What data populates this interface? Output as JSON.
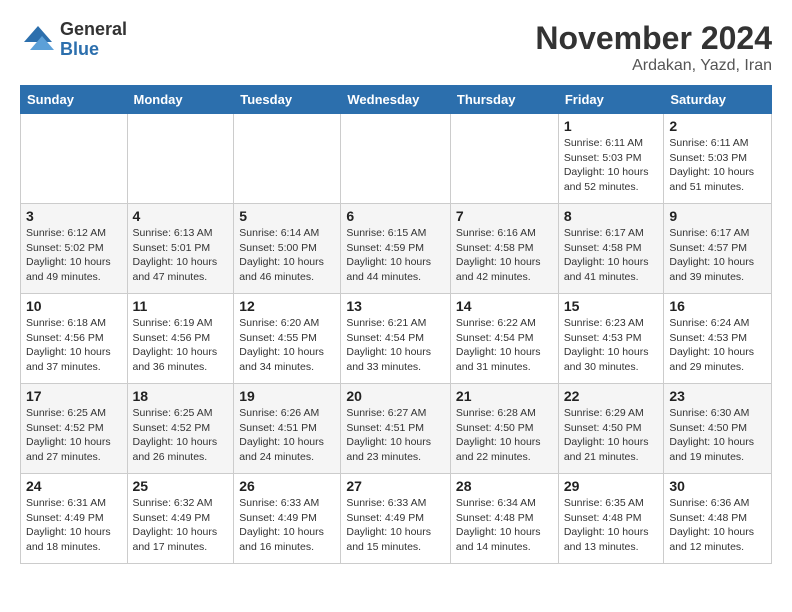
{
  "logo": {
    "general": "General",
    "blue": "Blue"
  },
  "title": "November 2024",
  "location": "Ardakan, Yazd, Iran",
  "weekdays": [
    "Sunday",
    "Monday",
    "Tuesday",
    "Wednesday",
    "Thursday",
    "Friday",
    "Saturday"
  ],
  "weeks": [
    [
      {
        "day": "",
        "info": ""
      },
      {
        "day": "",
        "info": ""
      },
      {
        "day": "",
        "info": ""
      },
      {
        "day": "",
        "info": ""
      },
      {
        "day": "",
        "info": ""
      },
      {
        "day": "1",
        "info": "Sunrise: 6:11 AM\nSunset: 5:03 PM\nDaylight: 10 hours\nand 52 minutes."
      },
      {
        "day": "2",
        "info": "Sunrise: 6:11 AM\nSunset: 5:03 PM\nDaylight: 10 hours\nand 51 minutes."
      }
    ],
    [
      {
        "day": "3",
        "info": "Sunrise: 6:12 AM\nSunset: 5:02 PM\nDaylight: 10 hours\nand 49 minutes."
      },
      {
        "day": "4",
        "info": "Sunrise: 6:13 AM\nSunset: 5:01 PM\nDaylight: 10 hours\nand 47 minutes."
      },
      {
        "day": "5",
        "info": "Sunrise: 6:14 AM\nSunset: 5:00 PM\nDaylight: 10 hours\nand 46 minutes."
      },
      {
        "day": "6",
        "info": "Sunrise: 6:15 AM\nSunset: 4:59 PM\nDaylight: 10 hours\nand 44 minutes."
      },
      {
        "day": "7",
        "info": "Sunrise: 6:16 AM\nSunset: 4:58 PM\nDaylight: 10 hours\nand 42 minutes."
      },
      {
        "day": "8",
        "info": "Sunrise: 6:17 AM\nSunset: 4:58 PM\nDaylight: 10 hours\nand 41 minutes."
      },
      {
        "day": "9",
        "info": "Sunrise: 6:17 AM\nSunset: 4:57 PM\nDaylight: 10 hours\nand 39 minutes."
      }
    ],
    [
      {
        "day": "10",
        "info": "Sunrise: 6:18 AM\nSunset: 4:56 PM\nDaylight: 10 hours\nand 37 minutes."
      },
      {
        "day": "11",
        "info": "Sunrise: 6:19 AM\nSunset: 4:56 PM\nDaylight: 10 hours\nand 36 minutes."
      },
      {
        "day": "12",
        "info": "Sunrise: 6:20 AM\nSunset: 4:55 PM\nDaylight: 10 hours\nand 34 minutes."
      },
      {
        "day": "13",
        "info": "Sunrise: 6:21 AM\nSunset: 4:54 PM\nDaylight: 10 hours\nand 33 minutes."
      },
      {
        "day": "14",
        "info": "Sunrise: 6:22 AM\nSunset: 4:54 PM\nDaylight: 10 hours\nand 31 minutes."
      },
      {
        "day": "15",
        "info": "Sunrise: 6:23 AM\nSunset: 4:53 PM\nDaylight: 10 hours\nand 30 minutes."
      },
      {
        "day": "16",
        "info": "Sunrise: 6:24 AM\nSunset: 4:53 PM\nDaylight: 10 hours\nand 29 minutes."
      }
    ],
    [
      {
        "day": "17",
        "info": "Sunrise: 6:25 AM\nSunset: 4:52 PM\nDaylight: 10 hours\nand 27 minutes."
      },
      {
        "day": "18",
        "info": "Sunrise: 6:25 AM\nSunset: 4:52 PM\nDaylight: 10 hours\nand 26 minutes."
      },
      {
        "day": "19",
        "info": "Sunrise: 6:26 AM\nSunset: 4:51 PM\nDaylight: 10 hours\nand 24 minutes."
      },
      {
        "day": "20",
        "info": "Sunrise: 6:27 AM\nSunset: 4:51 PM\nDaylight: 10 hours\nand 23 minutes."
      },
      {
        "day": "21",
        "info": "Sunrise: 6:28 AM\nSunset: 4:50 PM\nDaylight: 10 hours\nand 22 minutes."
      },
      {
        "day": "22",
        "info": "Sunrise: 6:29 AM\nSunset: 4:50 PM\nDaylight: 10 hours\nand 21 minutes."
      },
      {
        "day": "23",
        "info": "Sunrise: 6:30 AM\nSunset: 4:50 PM\nDaylight: 10 hours\nand 19 minutes."
      }
    ],
    [
      {
        "day": "24",
        "info": "Sunrise: 6:31 AM\nSunset: 4:49 PM\nDaylight: 10 hours\nand 18 minutes."
      },
      {
        "day": "25",
        "info": "Sunrise: 6:32 AM\nSunset: 4:49 PM\nDaylight: 10 hours\nand 17 minutes."
      },
      {
        "day": "26",
        "info": "Sunrise: 6:33 AM\nSunset: 4:49 PM\nDaylight: 10 hours\nand 16 minutes."
      },
      {
        "day": "27",
        "info": "Sunrise: 6:33 AM\nSunset: 4:49 PM\nDaylight: 10 hours\nand 15 minutes."
      },
      {
        "day": "28",
        "info": "Sunrise: 6:34 AM\nSunset: 4:48 PM\nDaylight: 10 hours\nand 14 minutes."
      },
      {
        "day": "29",
        "info": "Sunrise: 6:35 AM\nSunset: 4:48 PM\nDaylight: 10 hours\nand 13 minutes."
      },
      {
        "day": "30",
        "info": "Sunrise: 6:36 AM\nSunset: 4:48 PM\nDaylight: 10 hours\nand 12 minutes."
      }
    ]
  ]
}
